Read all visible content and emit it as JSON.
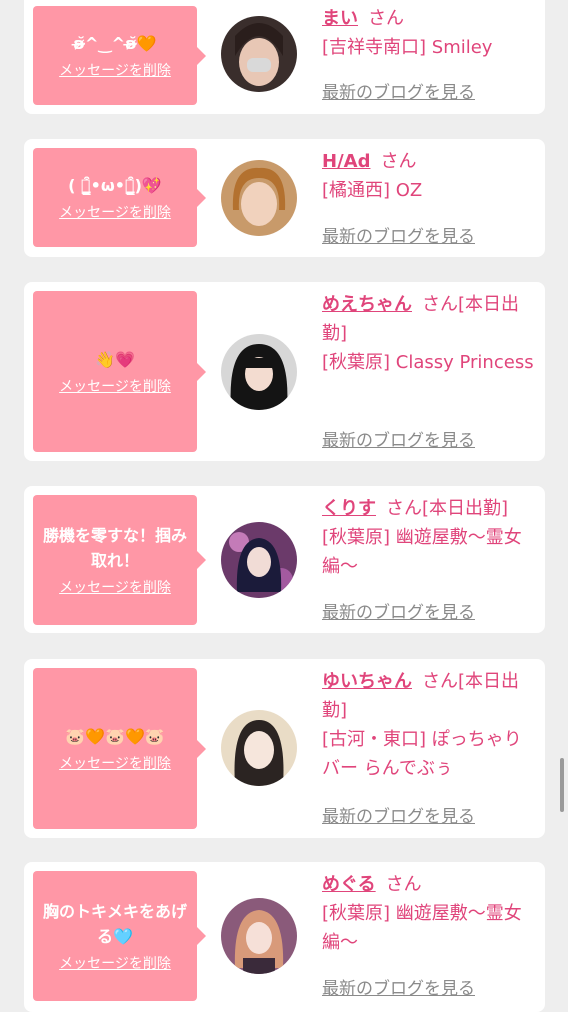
{
  "delete_label": "メッセージを削除",
  "blog_label": "最新のブログを見る",
  "san_label": "さん",
  "cards": [
    {
      "message": "ʚ̴̶̷̆^‿^ʚ̴̶̷̆🧡",
      "name": "まい",
      "suffix": "",
      "shop": "[吉祥寺南口] Smiley"
    },
    {
      "message": "( ฅ̳͒•ω•ฅ̳͒)💖",
      "name": "H/Ad",
      "suffix": "",
      "shop": "[橘通西] OZ"
    },
    {
      "message": "👋💗",
      "name": "めえちゃん",
      "suffix": "[本日出勤]",
      "shop": "[秋葉原] Classy Princess"
    },
    {
      "message": "勝機を零すな！掴み取れ！",
      "name": "くりす",
      "suffix": "[本日出勤]",
      "shop": "[秋葉原] 幽遊屋敷〜霊女編〜"
    },
    {
      "message": "🐷🧡🐷🧡🐷",
      "name": "ゆいちゃん",
      "suffix": "[本日出勤]",
      "shop": "[古河・東口] ぽっちゃりバー らんでぶぅ"
    },
    {
      "message": "胸のトキメキをあげる🩵",
      "name": "めぐる",
      "suffix": "",
      "shop": "[秋葉原] 幽遊屋敷〜霊女編〜"
    }
  ],
  "colors": {
    "accent": "#e0457b",
    "bubble": "#ff97a6",
    "background": "#eeeeee"
  }
}
